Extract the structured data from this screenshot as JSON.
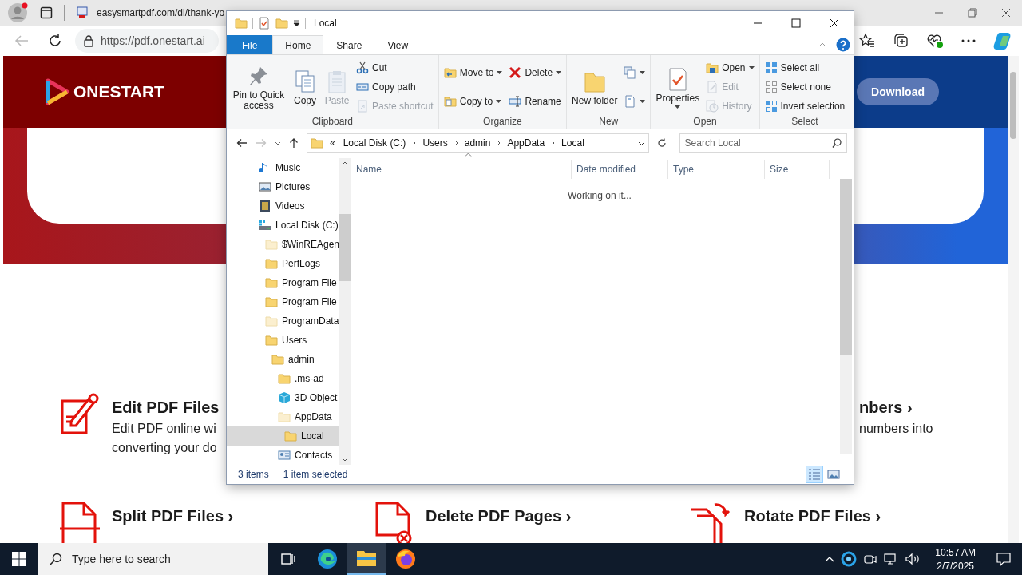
{
  "browser": {
    "tab": {
      "title": "easysmartpdf.com/dl/thank-yo"
    },
    "address": "https://pdf.onestart.ai",
    "page": {
      "logo": "ONESTART",
      "download": "Download",
      "feature_rows": [
        [
          {
            "kind": "full",
            "title": "Edit PDF Files",
            "lines": [
              "Edit PDF online wi",
              "converting your do"
            ]
          },
          {
            "kind": "partial",
            "title": "nbers ›",
            "lines": [
              "numbers into"
            ]
          }
        ],
        [
          {
            "kind": "full",
            "title": "Split PDF Files ›"
          },
          {
            "kind": "full",
            "title": "Delete PDF Pages ›"
          },
          {
            "kind": "full",
            "title": "Rotate PDF Files ›"
          }
        ]
      ]
    }
  },
  "explorer": {
    "title": "Local",
    "ribbon_tabs": [
      {
        "label": "File",
        "kind": "file",
        "selected": false
      },
      {
        "label": "Home",
        "kind": "tab",
        "selected": true
      },
      {
        "label": "Share",
        "kind": "tab",
        "selected": false
      },
      {
        "label": "View",
        "kind": "tab",
        "selected": false
      }
    ],
    "groups": [
      {
        "label": "Clipboard",
        "columns": [
          [
            {
              "label": "Pin to Quick access",
              "kind": "large",
              "disabled": false,
              "dropdown": false
            }
          ],
          [
            {
              "label": "Copy",
              "kind": "large",
              "disabled": false,
              "dropdown": false
            }
          ],
          [
            {
              "label": "Paste",
              "kind": "large",
              "disabled": true,
              "dropdown": false
            }
          ],
          [
            {
              "label": "Cut",
              "kind": "small",
              "disabled": false,
              "dropdown": false
            },
            {
              "label": "Copy path",
              "kind": "small",
              "disabled": false,
              "dropdown": false
            },
            {
              "label": "Paste shortcut",
              "kind": "small",
              "disabled": true,
              "dropdown": false
            }
          ]
        ]
      },
      {
        "label": "Organize",
        "columns": [
          [
            {
              "label": "Move to",
              "kind": "small",
              "disabled": false,
              "dropdown": true
            },
            {
              "label": "Copy to",
              "kind": "small",
              "disabled": false,
              "dropdown": true
            }
          ],
          [
            {
              "label": "Delete",
              "kind": "small",
              "disabled": false,
              "dropdown": true
            },
            {
              "label": "Rename",
              "kind": "small",
              "disabled": false,
              "dropdown": false
            }
          ]
        ]
      },
      {
        "label": "New",
        "columns": [
          [
            {
              "label": "New folder",
              "kind": "large",
              "disabled": false,
              "dropdown": false
            }
          ],
          [
            {
              "kind": "small",
              "disabled": false,
              "dropdown": true
            },
            {
              "kind": "small",
              "disabled": false,
              "dropdown": true
            }
          ]
        ]
      },
      {
        "label": "Open",
        "columns": [
          [
            {
              "label": "Properties",
              "kind": "large",
              "disabled": false,
              "dropdown": true
            }
          ],
          [
            {
              "label": "Open",
              "kind": "small",
              "disabled": false,
              "dropdown": true
            },
            {
              "label": "Edit",
              "kind": "small",
              "disabled": true,
              "dropdown": false
            },
            {
              "label": "History",
              "kind": "small",
              "disabled": true,
              "dropdown": false
            }
          ]
        ]
      },
      {
        "label": "Select",
        "columns": [
          [
            {
              "label": "Select all",
              "kind": "small",
              "disabled": false,
              "dropdown": false
            },
            {
              "label": "Select none",
              "kind": "small",
              "disabled": false,
              "dropdown": false
            },
            {
              "label": "Invert selection",
              "kind": "small",
              "disabled": false,
              "dropdown": false
            }
          ]
        ]
      }
    ],
    "address": {
      "overflow": "«",
      "crumbs": [
        "Local Disk (C:)",
        "Users",
        "admin",
        "AppData",
        "Local"
      ]
    },
    "search": {
      "placeholder": "Search Local"
    },
    "tree": [
      {
        "label": "Music",
        "kind": "music",
        "selected": false
      },
      {
        "label": "Pictures",
        "kind": "pictures",
        "selected": false
      },
      {
        "label": "Videos",
        "kind": "videos",
        "selected": false
      },
      {
        "label": "Local Disk (C:)",
        "kind": "drive",
        "selected": false,
        "children": [
          {
            "label": "$WinREAgen",
            "kind": "hidden-folder",
            "selected": false
          },
          {
            "label": "PerfLogs",
            "kind": "folder",
            "selected": false
          },
          {
            "label": "Program File",
            "kind": "folder",
            "selected": false
          },
          {
            "label": "Program File",
            "kind": "folder",
            "selected": false
          },
          {
            "label": "ProgramData",
            "kind": "hidden-folder",
            "selected": false
          },
          {
            "label": "Users",
            "kind": "folder",
            "selected": false,
            "children": [
              {
                "label": "admin",
                "kind": "folder",
                "selected": false,
                "children": [
                  {
                    "label": ".ms-ad",
                    "kind": "folder",
                    "selected": false
                  },
                  {
                    "label": "3D Object",
                    "kind": "cube",
                    "selected": false
                  },
                  {
                    "label": "AppData",
                    "kind": "hidden-folder",
                    "selected": false,
                    "children": [
                      {
                        "label": "Local",
                        "kind": "folder",
                        "selected": true
                      }
                    ]
                  },
                  {
                    "label": "Contacts",
                    "kind": "contacts",
                    "selected": false
                  }
                ]
              }
            ]
          }
        ]
      }
    ],
    "columns": [
      "Name",
      "Date modified",
      "Type",
      "Size"
    ],
    "message": "Working on it...",
    "status": {
      "items": "3 items",
      "selection": "1 item selected"
    },
    "views": [
      {
        "kind": "details",
        "selected": true
      },
      {
        "kind": "large-icons",
        "selected": false
      }
    ]
  },
  "taskbar": {
    "search": {
      "placeholder": "Type here to search"
    },
    "apps": [
      {
        "kind": "task-view",
        "active": false
      },
      {
        "kind": "edge",
        "active": false
      },
      {
        "kind": "explorer",
        "active": true
      },
      {
        "kind": "firefox",
        "active": false
      }
    ],
    "time": "10:57 AM",
    "date": "2/7/2025"
  }
}
